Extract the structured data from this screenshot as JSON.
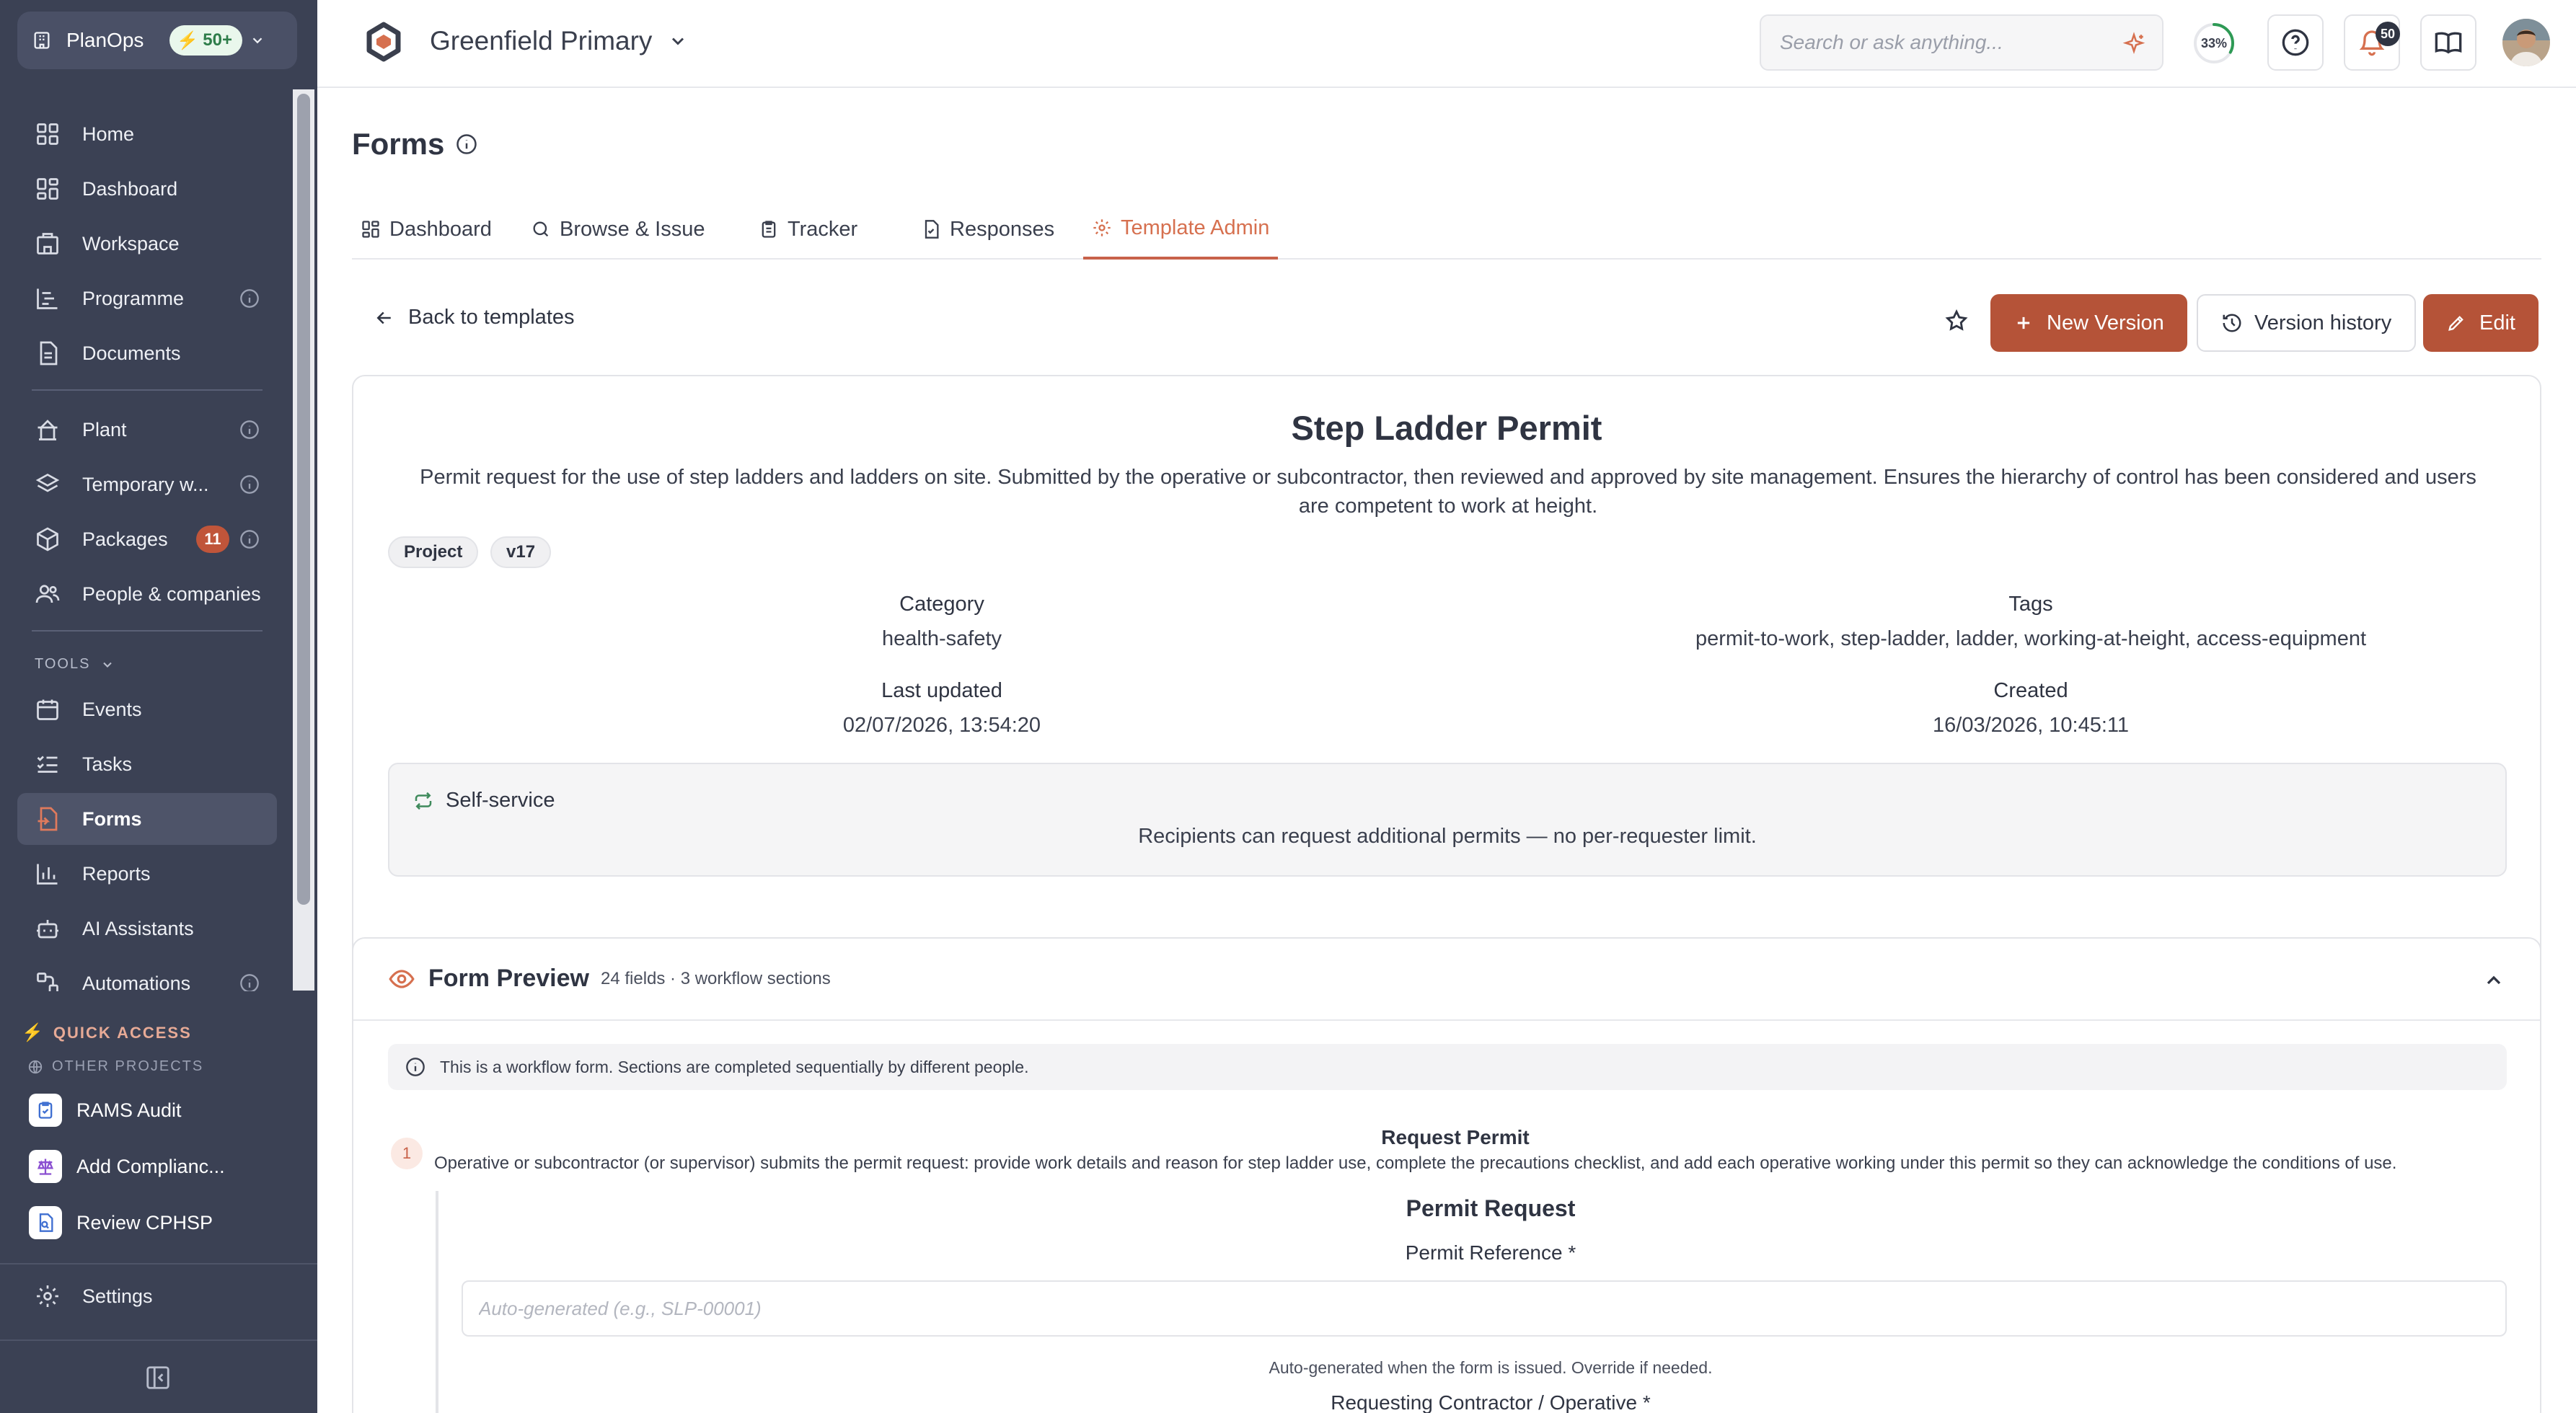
{
  "sidebar": {
    "org_name": "PlanOps",
    "org_badge": "50+",
    "items": [
      {
        "label": "Home",
        "icon": "grid-icon"
      },
      {
        "label": "Dashboard",
        "icon": "dashboard-icon"
      },
      {
        "label": "Workspace",
        "icon": "building-icon"
      },
      {
        "label": "Programme",
        "icon": "gantt-icon"
      },
      {
        "label": "Documents",
        "icon": "document-icon"
      },
      {
        "label": "Plant",
        "icon": "crane-icon"
      },
      {
        "label": "Temporary w...",
        "icon": "layers-icon"
      },
      {
        "label": "Packages",
        "icon": "package-icon",
        "count": "11"
      },
      {
        "label": "People & companies",
        "icon": "people-icon"
      }
    ],
    "tools_heading": "TOOLS",
    "tools": [
      {
        "label": "Events",
        "icon": "calendar-icon"
      },
      {
        "label": "Tasks",
        "icon": "tasks-icon"
      },
      {
        "label": "Forms",
        "icon": "form-icon"
      },
      {
        "label": "Reports",
        "icon": "bar-chart-icon"
      },
      {
        "label": "AI Assistants",
        "icon": "bot-icon"
      },
      {
        "label": "Automations",
        "icon": "workflow-icon"
      }
    ],
    "quick_access_heading": "QUICK ACCESS",
    "other_projects_heading": "OTHER PROJECTS",
    "quick_access": [
      {
        "label": "RAMS Audit"
      },
      {
        "label": "Add Complianc..."
      },
      {
        "label": "Review CPHSP"
      }
    ],
    "settings_label": "Settings"
  },
  "topbar": {
    "project_title": "Greenfield Primary",
    "search_placeholder": "Search or ask anything...",
    "progress_label": "33%",
    "progress_value": 0.33,
    "notifications_count": "50"
  },
  "page": {
    "title": "Forms",
    "tabs": [
      {
        "label": "Dashboard"
      },
      {
        "label": "Browse & Issue"
      },
      {
        "label": "Tracker"
      },
      {
        "label": "Responses"
      },
      {
        "label": "Template Admin"
      }
    ],
    "active_tab": "Template Admin",
    "back_label": "Back to templates",
    "new_version_label": "New Version",
    "version_history_label": "Version history",
    "edit_label": "Edit"
  },
  "template": {
    "title": "Step Ladder Permit",
    "description": "Permit request for the use of step ladders and ladders on site. Submitted by the operative or subcontractor, then reviewed and approved by site management. Ensures the hierarchy of control has been considered and users are competent to work at height.",
    "scope_chip": "Project",
    "version_chip": "v17",
    "category_label": "Category",
    "category_value": "health-safety",
    "tags_label": "Tags",
    "tags_value": "permit-to-work, step-ladder, ladder, working-at-height, access-equipment",
    "last_updated_label": "Last updated",
    "last_updated_value": "02/07/2026, 13:54:20",
    "created_label": "Created",
    "created_value": "16/03/2026, 10:45:11",
    "self_service_label": "Self-service",
    "self_service_text": "Recipients can request additional permits — no per-requester limit."
  },
  "preview": {
    "title": "Form Preview",
    "meta": "24 fields · 3 workflow sections",
    "workflow_note": "This is a workflow form. Sections are completed sequentially by different people.",
    "step_number": "1",
    "step_title": "Request Permit",
    "step_description": "Operative or subcontractor (or supervisor) submits the permit request: provide work details and reason for step ladder use, complete the precautions checklist, and add each operative working under this permit so they can acknowledge the conditions of use.",
    "section_title": "Permit Request",
    "field1_label": "Permit Reference *",
    "field1_placeholder": "Auto-generated (e.g., SLP-00001)",
    "field1_help": "Auto-generated when the form is issued. Override if needed.",
    "field2_label": "Requesting Contractor / Operative *"
  },
  "colors": {
    "sidebar_bg": "#3b4154",
    "accent": "#b55338",
    "active_tab": "#d6704f"
  }
}
